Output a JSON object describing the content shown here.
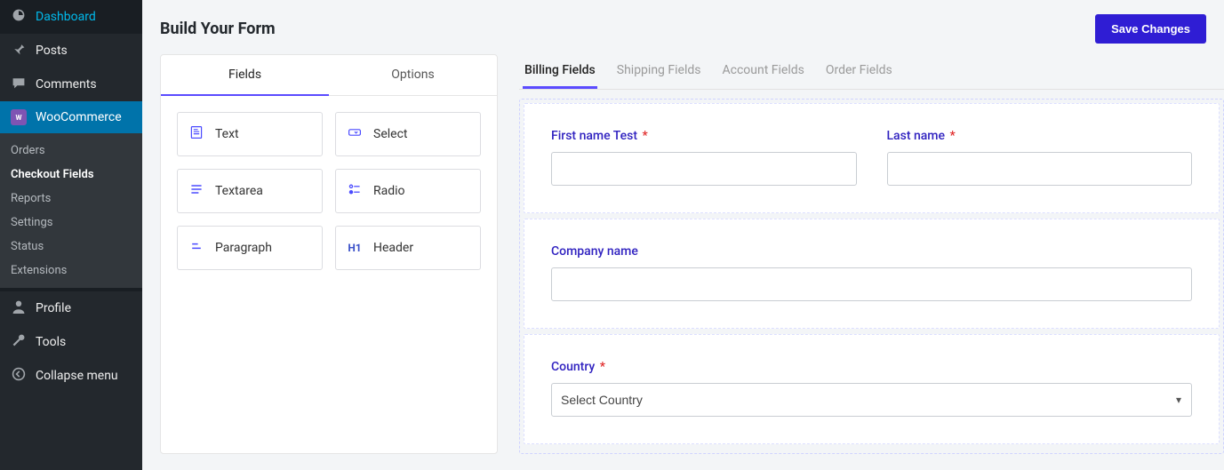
{
  "sidebar": {
    "items": [
      {
        "label": "Dashboard",
        "icon": "dashboard-icon"
      },
      {
        "label": "Posts",
        "icon": "pin-icon"
      },
      {
        "label": "Comments",
        "icon": "comment-icon"
      },
      {
        "label": "WooCommerce",
        "icon": "woo-icon"
      },
      {
        "label": "Profile",
        "icon": "user-icon"
      },
      {
        "label": "Tools",
        "icon": "wrench-icon"
      },
      {
        "label": "Collapse menu",
        "icon": "collapse-icon"
      }
    ],
    "woo_sub": [
      {
        "label": "Orders"
      },
      {
        "label": "Checkout Fields",
        "current": true
      },
      {
        "label": "Reports"
      },
      {
        "label": "Settings"
      },
      {
        "label": "Status"
      },
      {
        "label": "Extensions"
      }
    ]
  },
  "header": {
    "title": "Build Your Form",
    "save_label": "Save Changes"
  },
  "palette": {
    "tabs": {
      "fields": "Fields",
      "options": "Options"
    },
    "types": {
      "text": "Text",
      "select": "Select",
      "textarea": "Textarea",
      "radio": "Radio",
      "paragraph": "Paragraph",
      "header": "Header"
    }
  },
  "builder": {
    "tabs": {
      "billing": "Billing Fields",
      "shipping": "Shipping Fields",
      "account": "Account Fields",
      "order": "Order Fields"
    }
  },
  "form": {
    "first_name_label": "First name Test",
    "last_name_label": "Last name",
    "company_label": "Company name",
    "country_label": "Country",
    "country_placeholder": "Select Country"
  }
}
